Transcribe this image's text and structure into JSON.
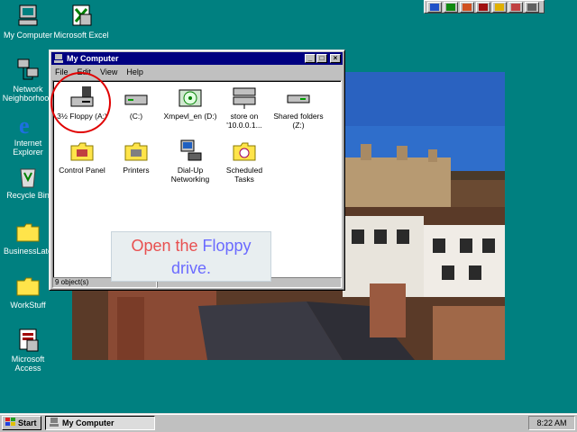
{
  "desktop": {
    "icons": [
      {
        "label": "My Computer"
      },
      {
        "label": "Microsoft Excel"
      },
      {
        "label": "Network Neighborhood"
      },
      {
        "label": "Internet Explorer"
      },
      {
        "label": "Recycle Bin"
      },
      {
        "label": "BusinessLate"
      },
      {
        "label": "WorkStuff"
      },
      {
        "label": "Microsoft Access"
      }
    ]
  },
  "window": {
    "title": "My Computer",
    "menu": [
      "File",
      "Edit",
      "View",
      "Help"
    ],
    "items": [
      {
        "label": "3½ Floppy (A:)",
        "icon": "floppy-drive-icon"
      },
      {
        "label": "(C:)",
        "icon": "hard-drive-icon"
      },
      {
        "label": "Xmpevl_en (D:)",
        "icon": "cd-drive-icon"
      },
      {
        "label": "store on '10.0.0.1...",
        "icon": "network-drive-icon"
      },
      {
        "label": "Shared folders (Z:)",
        "icon": "network-drive-icon"
      },
      {
        "label": "Control Panel",
        "icon": "control-panel-icon"
      },
      {
        "label": "Printers",
        "icon": "printers-folder-icon"
      },
      {
        "label": "Dial-Up Networking",
        "icon": "dialup-icon"
      },
      {
        "label": "Scheduled Tasks",
        "icon": "scheduled-tasks-icon"
      }
    ],
    "status": "9 object(s)"
  },
  "callout": {
    "part1": "Open the",
    "part2": "Floppy drive."
  },
  "taskbar": {
    "start": "Start",
    "task": "My Computer",
    "clock": "8:22 AM"
  },
  "colors": {
    "desktop": "#008080",
    "titlebar": "#000080",
    "highlight_circle": "#e00000"
  }
}
